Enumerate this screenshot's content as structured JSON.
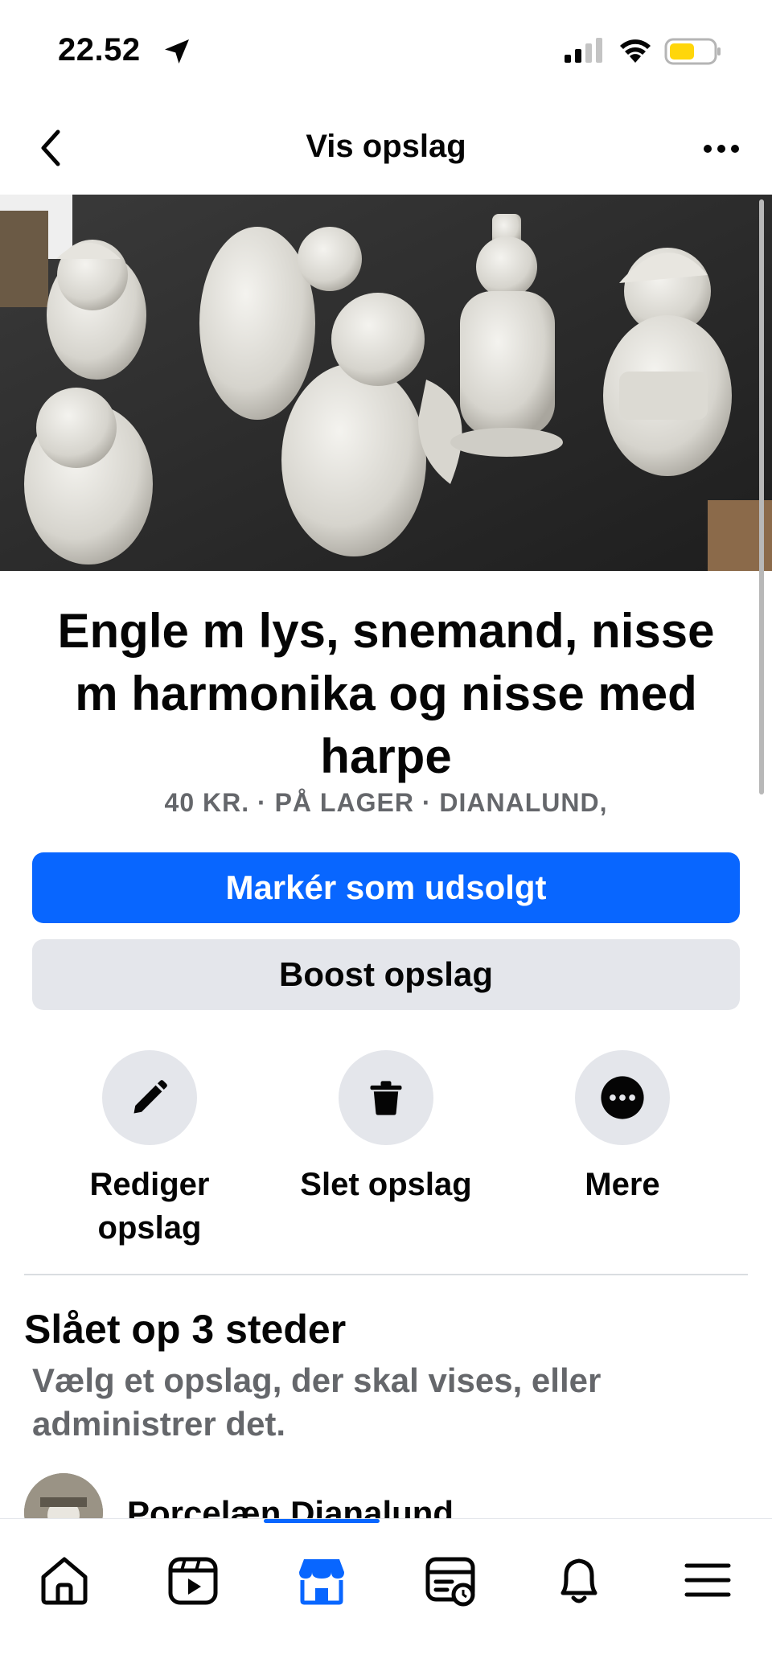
{
  "status_bar": {
    "time": "22.52",
    "battery_color": "#ffd60a"
  },
  "header": {
    "title": "Vis opslag"
  },
  "listing": {
    "title": "Engle m lys, snemand, nisse m harmonika og nisse med harpe",
    "meta": "40 KR. · PÅ LAGER · DIANALUND,"
  },
  "buttons": {
    "primary": "Markér som udsolgt",
    "secondary": "Boost opslag"
  },
  "actions": [
    {
      "label": "Rediger opslag",
      "icon": "pencil-icon"
    },
    {
      "label": "Slet opslag",
      "icon": "trash-icon"
    },
    {
      "label": "Mere",
      "icon": "more-dots-icon"
    }
  ],
  "posted_section": {
    "title": "Slået op 3 steder",
    "subtitle": "Vælg et opslag, der skal vises, eller administrer det.",
    "group_name": "Porcelæn Dianalund"
  },
  "bottom_nav": [
    "home-icon",
    "video-icon",
    "marketplace-icon",
    "feeds-icon",
    "bell-icon",
    "menu-icon"
  ],
  "colors": {
    "accent": "#0866ff",
    "secondary_button": "#e4e6eb",
    "muted_text": "#65676b"
  }
}
